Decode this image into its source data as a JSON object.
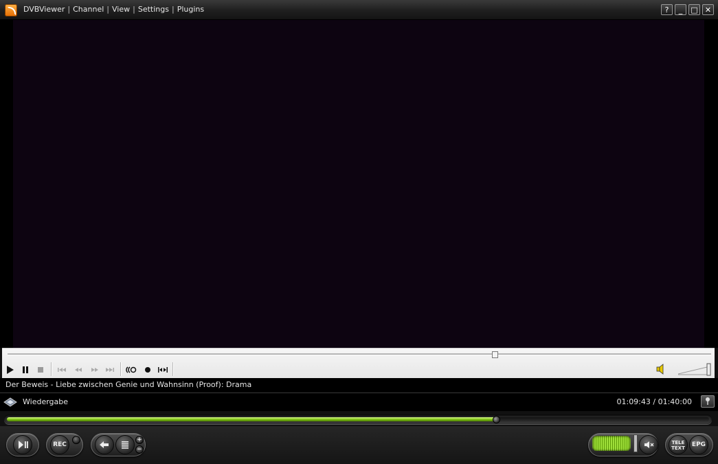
{
  "titlebar": {
    "app_name": "DVBViewer",
    "menu": [
      "Channel",
      "View",
      "Settings",
      "Plugins"
    ],
    "separator": "|",
    "buttons": {
      "help": "?",
      "minimize": "_",
      "maximize": "□",
      "close": "✕"
    }
  },
  "video": {
    "background": "#0d0411"
  },
  "controls": {
    "seek_position": 0.7,
    "icons": [
      "play-icon",
      "pause-icon",
      "stop-icon",
      "skip-back-icon",
      "rewind-icon",
      "fast-forward-icon",
      "skip-forward-icon",
      "timeshift-icon",
      "record-icon",
      "jump-icon",
      "speaker-icon",
      "volume-slider"
    ]
  },
  "program": {
    "title": "Der Beweis - Liebe zwischen Genie und Wahnsinn (Proof): Drama"
  },
  "status": {
    "state": "Wiedergabe",
    "time": "01:09:43 / 01:40:00"
  },
  "progress": {
    "fraction": 0.697
  },
  "bottom": {
    "rec_label": "REC",
    "teletext_label_1": "TELE",
    "teletext_label_2": "TEXT",
    "epg_label": "EPG",
    "plus": "+",
    "minus": "−",
    "volume_level": 0.9
  },
  "colors": {
    "accent_green": "#7cbd12",
    "app_icon": "#e56b00"
  }
}
